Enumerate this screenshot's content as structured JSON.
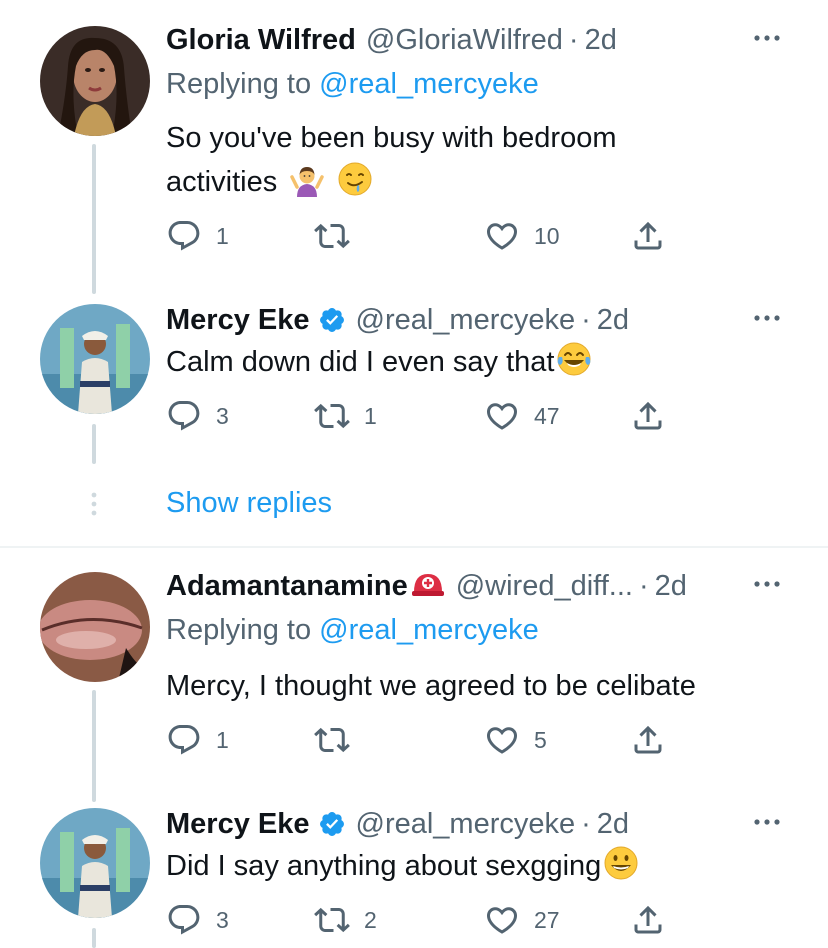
{
  "tweets": [
    {
      "name": "Gloria Wilfred",
      "handle": "@GloriaWilfred",
      "dot": "·",
      "time": "2d",
      "replying_prefix": "Replying to",
      "replying_to": "@real_mercyeke",
      "text_line1": "So you've been busy with bedroom",
      "text_line2": "activities",
      "emojis": [
        "person-shrugging-emoji",
        "drooling-face-emoji"
      ],
      "reply_count": "1",
      "retweet_count": "",
      "like_count": "10"
    },
    {
      "name": "Mercy Eke",
      "handle": "@real_mercyeke",
      "dot": "·",
      "time": "2d",
      "verified": true,
      "text": "Calm down did I even say that",
      "emojis": [
        "tears-of-joy-emoji"
      ],
      "reply_count": "3",
      "retweet_count": "1",
      "like_count": "47"
    },
    {
      "name": "Adamantanamine",
      "handle": "@wired_diff...",
      "dot": "·",
      "time": "2d",
      "emojis": [
        "rescue-helmet-emoji"
      ],
      "replying_prefix": "Replying to",
      "replying_to": "@real_mercyeke",
      "text": "Mercy, I thought we agreed to be celibate",
      "reply_count": "1",
      "retweet_count": "",
      "like_count": "5"
    },
    {
      "name": "Mercy Eke",
      "handle": "@real_mercyeke",
      "dot": "·",
      "time": "2d",
      "verified": true,
      "text": "Did I say anything about sexgging",
      "emojis": [
        "grinning-face-emoji"
      ],
      "reply_count": "3",
      "retweet_count": "2",
      "like_count": "27"
    }
  ],
  "show_replies": "Show replies",
  "colors": {
    "accent": "#1d9bf0",
    "secondary_text": "#536471",
    "primary_text": "#0f1419",
    "thread_line": "#cfd9de"
  }
}
